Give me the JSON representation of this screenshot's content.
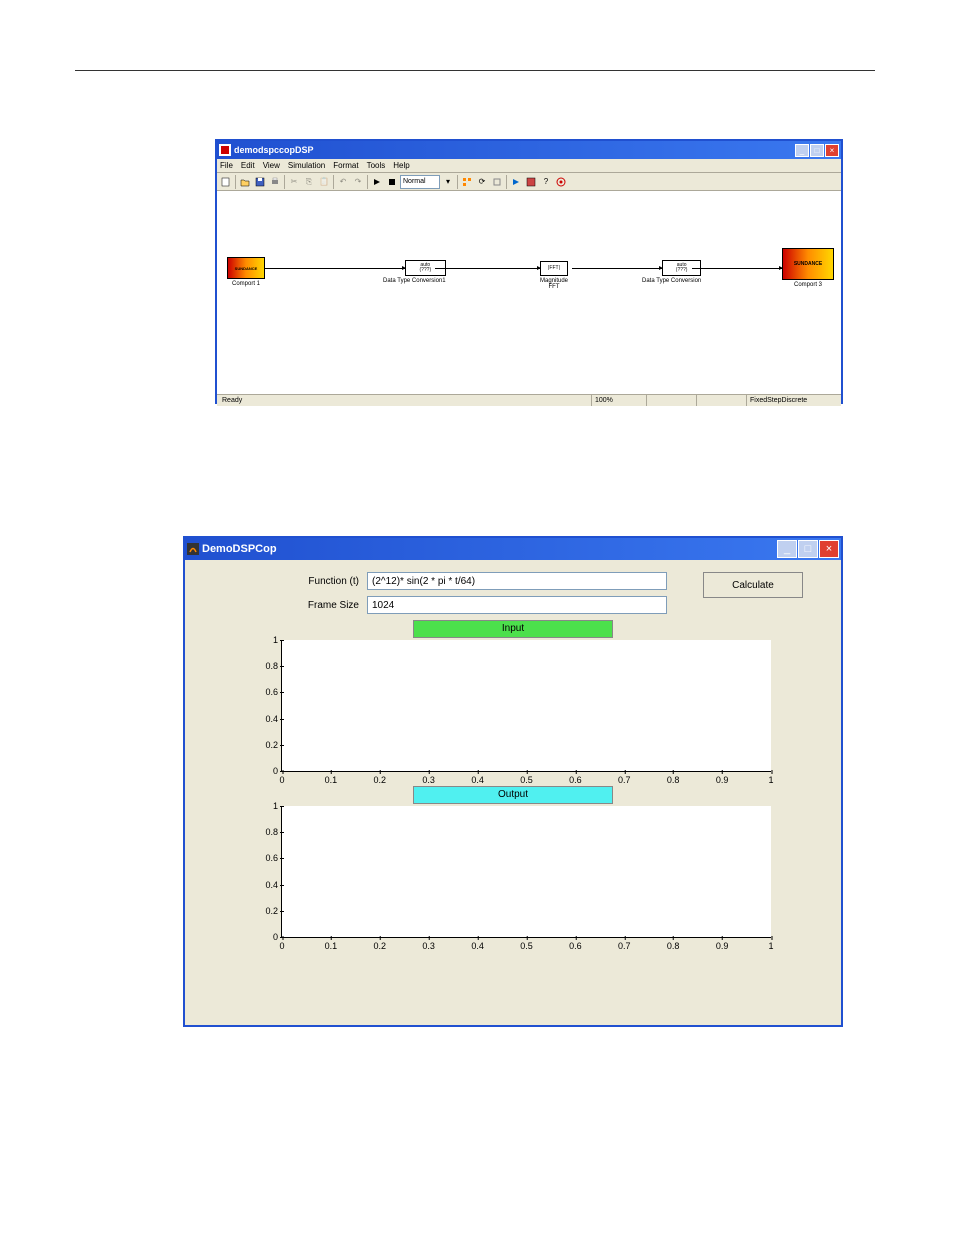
{
  "simulink": {
    "title": "demodspccopDSP",
    "menus": [
      "File",
      "Edit",
      "View",
      "Simulation",
      "Format",
      "Tools",
      "Help"
    ],
    "mode": "Normal",
    "status_left": "Ready",
    "status_zoom": "100%",
    "status_solver": "FixedStepDiscrete",
    "blocks": {
      "comport1": {
        "logo": "SUNDANCE",
        "label": "Comport 1"
      },
      "dtc1": {
        "line1": "auto",
        "line2": "(???)",
        "label": "Data Type Conversion1"
      },
      "fft": {
        "line1": "|FFT|",
        "label1": "Magnitude",
        "label2": "FFT"
      },
      "dtc2": {
        "line1": "auto",
        "line2": "(???)",
        "label": "Data Type Conversion"
      },
      "comport3": {
        "logo": "SUNDANCE",
        "label": "Comport 3"
      }
    }
  },
  "demo": {
    "title": "DemoDSPCop",
    "labels": {
      "function": "Function (t)",
      "framesize": "Frame Size"
    },
    "inputs": {
      "function": "(2^12)* sin(2 * pi * t/64)",
      "framesize": "1024"
    },
    "buttons": {
      "calculate": "Calculate"
    },
    "legends": {
      "input": "Input",
      "output": "Output"
    }
  },
  "chart_data": [
    {
      "type": "line",
      "title": "Input",
      "x": [],
      "y": [],
      "xlabel": "",
      "ylabel": "",
      "xlim": [
        0,
        1
      ],
      "ylim": [
        0,
        1
      ],
      "xticks": [
        0,
        0.1,
        0.2,
        0.3,
        0.4,
        0.5,
        0.6,
        0.7,
        0.8,
        0.9,
        1
      ],
      "yticks": [
        0,
        0.2,
        0.4,
        0.6,
        0.8,
        1
      ]
    },
    {
      "type": "line",
      "title": "Output",
      "x": [],
      "y": [],
      "xlabel": "",
      "ylabel": "",
      "xlim": [
        0,
        1
      ],
      "ylim": [
        0,
        1
      ],
      "xticks": [
        0,
        0.1,
        0.2,
        0.3,
        0.4,
        0.5,
        0.6,
        0.7,
        0.8,
        0.9,
        1
      ],
      "yticks": [
        0,
        0.2,
        0.4,
        0.6,
        0.8,
        1
      ]
    }
  ]
}
